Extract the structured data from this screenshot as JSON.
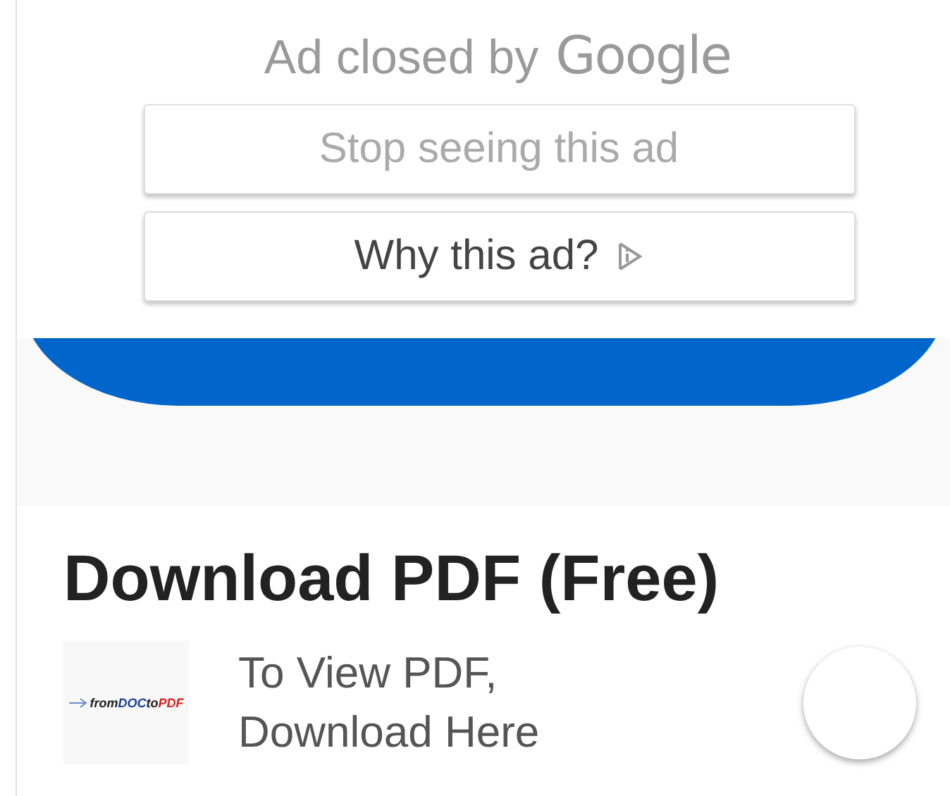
{
  "ad_notice": {
    "prefix": "Ad closed by",
    "brand": "Google"
  },
  "ad_buttons": [
    {
      "label": "Stop seeing this ad",
      "kind": "muted"
    },
    {
      "label": "Why this ad?",
      "kind": "info"
    }
  ],
  "heading": "Download PDF (Free)",
  "listing": {
    "logo": [
      {
        "text": "from",
        "color": "#222222"
      },
      {
        "text": "DOC",
        "color": "#1d3f9a"
      },
      {
        "text": "to",
        "color": "#222222"
      },
      {
        "text": "PDF",
        "color": "#e02020"
      }
    ],
    "lines": [
      "To View PDF,",
      "Download Here"
    ]
  }
}
